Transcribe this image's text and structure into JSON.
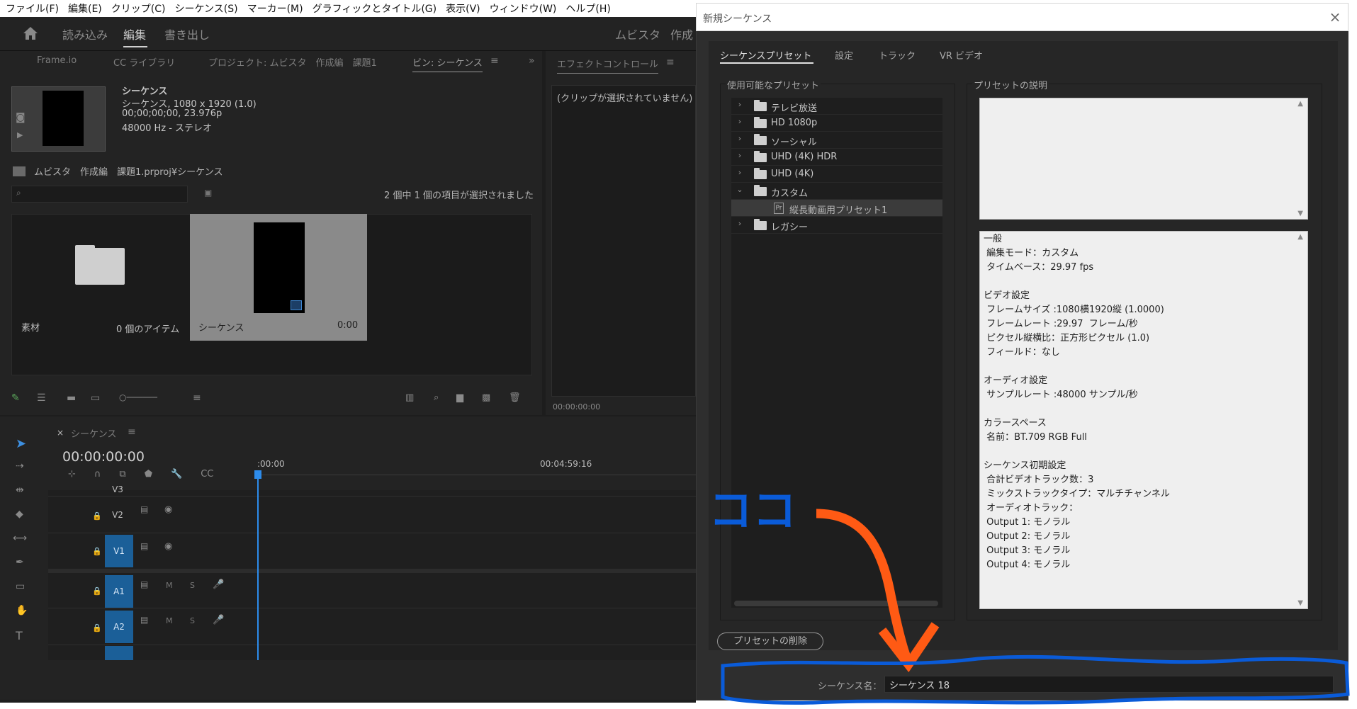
{
  "menubar": {
    "items": [
      "ファイル(F)",
      "編集(E)",
      "クリップ(C)",
      "シーケンス(S)",
      "マーカー(M)",
      "グラフィックとタイトル(G)",
      "表示(V)",
      "ウィンドウ(W)",
      "ヘルプ(H)"
    ]
  },
  "workspace": {
    "tabs": [
      "読み込み",
      "編集",
      "書き出し"
    ],
    "active": "編集",
    "right_title": "ムビスタ",
    "right_title2": "作成"
  },
  "project_panel": {
    "tabs": [
      "Frame.io",
      "CC ライブラリ",
      "プロジェクト: ムビスタ　作成編　課題1",
      "ビン: シーケンス"
    ],
    "seq_title": "シーケンス",
    "seq_line1": "シーケンス, 1080 x 1920 (1.0)",
    "seq_line2": "00;00;00;00, 23.976p",
    "seq_line3": "48000 Hz - ステレオ",
    "breadcrumb": "ムビスタ　作成編　課題1.prproj¥シーケンス",
    "selected_count": "2 個中 1 個の項目が選択されました",
    "items": [
      {
        "name": "素材",
        "meta": "0 個のアイテム"
      },
      {
        "name": "シーケンス",
        "meta": "0:00"
      }
    ]
  },
  "effect_panel": {
    "tab": "エフェクトコントロール",
    "empty_text": "(クリップが選択されていません)",
    "timecode": "00:00:00:00"
  },
  "timeline": {
    "tab": "シーケンス",
    "timecode": "00:00:00:00",
    "ruler_start": ":00:00",
    "ruler_mid": "00:04:59:16",
    "tracks": [
      "V3",
      "V2",
      "V1",
      "A1",
      "A2"
    ]
  },
  "dialog": {
    "title": "新規シーケンス",
    "tabs": [
      "シーケンスプリセット",
      "設定",
      "トラック",
      "VR ビデオ"
    ],
    "presets_header": "使用可能なプリセット",
    "presets": [
      {
        "label": "テレビ放送",
        "expanded": false
      },
      {
        "label": "HD 1080p",
        "expanded": false
      },
      {
        "label": "ソーシャル",
        "expanded": false
      },
      {
        "label": "UHD (4K) HDR",
        "expanded": false
      },
      {
        "label": "UHD (4K)",
        "expanded": false
      },
      {
        "label": "カスタム",
        "expanded": true
      },
      {
        "label": "縦長動画用プリセット1",
        "child": true
      },
      {
        "label": "レガシー",
        "expanded": false
      }
    ],
    "description_header": "プリセットの説明",
    "description": "一般\n 編集モード：カスタム\n タイムベース：29.97 fps\n\nビデオ設定\n フレームサイズ :1080横1920縦 (1.0000)\n フレームレート :29.97  フレーム/秒\n ピクセル縦横比：正方形ピクセル (1.0)\n フィールド：なし\n\nオーディオ設定\n サンプルレート :48000 サンプル/秒\n\nカラースペース\n 名前：BT.709 RGB Full\n\nシーケンス初期設定\n 合計ビデオトラック数：3\n ミックストラックタイプ：マルチチャンネル\n オーディオトラック：\n Output 1: モノラル\n Output 2: モノラル\n Output 3: モノラル\n Output 4: モノラル",
    "delete_button": "プリセットの削除",
    "seqname_label": "シーケンス名：",
    "seqname_value": "シーケンス 18"
  },
  "annotation": {
    "text": "ココ",
    "blue": "#0a5bd8",
    "orange": "#ff5a14"
  }
}
